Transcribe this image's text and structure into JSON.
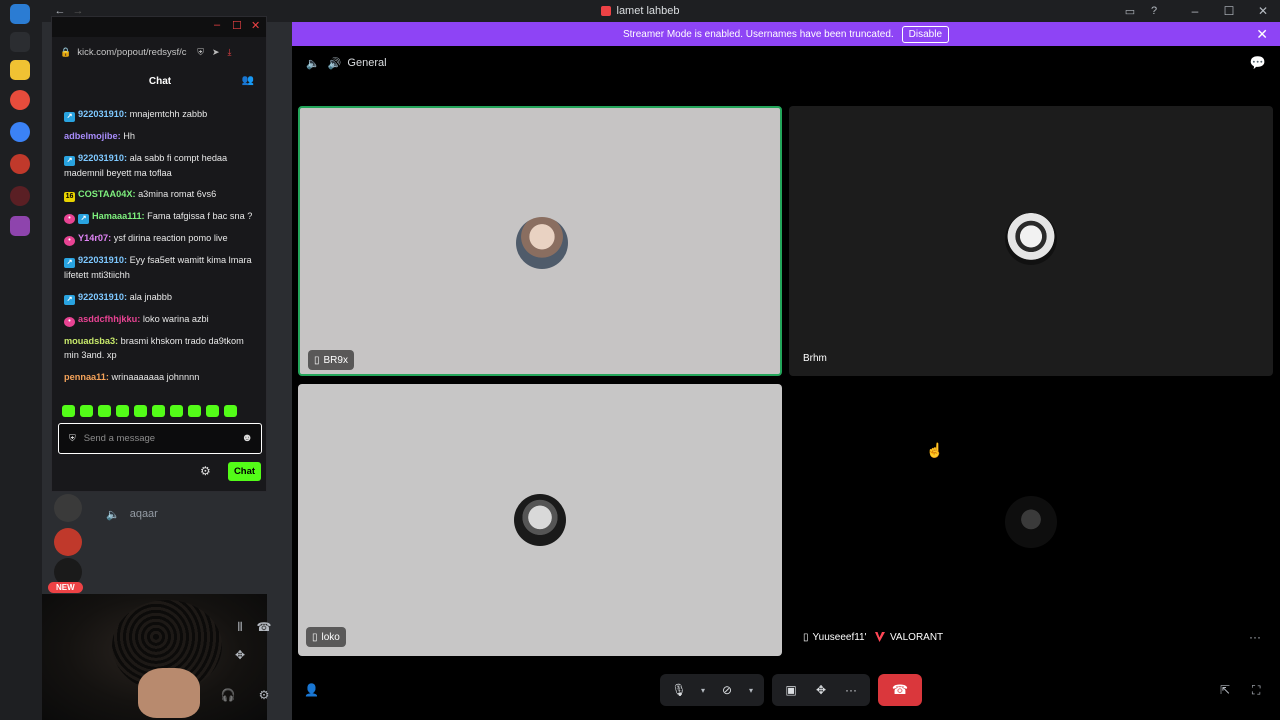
{
  "titlebar": {
    "title": "lamet lahbeb",
    "back_label": "←",
    "forward_label": "→",
    "inbox_icon": "▭",
    "help_icon": "?",
    "minimize": "–",
    "maximize": "☐",
    "close": "✕"
  },
  "banner": {
    "text": "Streamer Mode is enabled. Usernames have been truncated.",
    "button": "Disable",
    "close": "✕"
  },
  "popout": {
    "url": "kick.com/popout/redsysf/c",
    "header": "Chat",
    "messages": [
      {
        "badges": [
          "blue"
        ],
        "user": "922031910:",
        "text": " mnajemtchh zabbb",
        "color": "#7ec8ff"
      },
      {
        "badges": [],
        "user": "adbelmojibe:",
        "text": " Hh",
        "color": "#a78bfa"
      },
      {
        "badges": [
          "blue"
        ],
        "user": "922031910:",
        "text": " ala sabb fi compt hedaa mademnil beyett ma toflaa",
        "color": "#7ec8ff"
      },
      {
        "badges": [
          "yellow"
        ],
        "user": "COSTAA04X:",
        "text": " a3mina romat 6vs6",
        "color": "#7ef07e"
      },
      {
        "badges": [
          "pink",
          "blue"
        ],
        "user": "Hamaaa111:",
        "text": " Fama tafgissa f bac sna ?",
        "color": "#7ef07e"
      },
      {
        "badges": [
          "pink"
        ],
        "user": "Y14r07:",
        "text": " ysf dirina reaction pomo live",
        "color": "#e084f5"
      },
      {
        "badges": [
          "blue"
        ],
        "user": "922031910:",
        "text": " Eyy fsa5ett wamitt kima lmara lifetett mti3tiichh",
        "color": "#7ec8ff"
      },
      {
        "badges": [
          "blue"
        ],
        "user": "922031910:",
        "text": " ala jnabbb",
        "color": "#7ec8ff"
      },
      {
        "badges": [
          "pink"
        ],
        "user": "asddcfhhjkku:",
        "text": " loko warina azbi",
        "color": "#e84393"
      },
      {
        "badges": [],
        "user": "mouadsba3:",
        "text": " brasmi khskom trado da9tkom min 3and. xp",
        "color": "#c7e86b"
      },
      {
        "badges": [],
        "user": "pennaa11:",
        "text": " wrinaaaaaaa johnnnn",
        "color": "#f5a35a"
      }
    ],
    "input_placeholder": "Send a message",
    "chat_button": "Chat"
  },
  "sidebar": {
    "voice_user": "aqaar",
    "new_badge": "NEW"
  },
  "stage": {
    "channel": "General",
    "tiles": [
      {
        "name": "BR9x",
        "mobile": true
      },
      {
        "name": "Brhm",
        "mobile": false
      },
      {
        "name": "loko",
        "mobile": true
      },
      {
        "name": "Yuuseeef11'",
        "mobile": true,
        "activity": "VALORANT"
      }
    ]
  },
  "colors": {
    "banner": "#8e44f5",
    "speaking_border": "#23a55a",
    "kick_green": "#53fc18",
    "hangup": "#da373c"
  },
  "icons": {
    "mobile": "▯",
    "more": "···",
    "mic": "🎙",
    "camera_off": "⊘",
    "share": "▣",
    "activities": "✥",
    "hangup": "☎",
    "popout": "⇱",
    "fullscreen": "⛶"
  }
}
